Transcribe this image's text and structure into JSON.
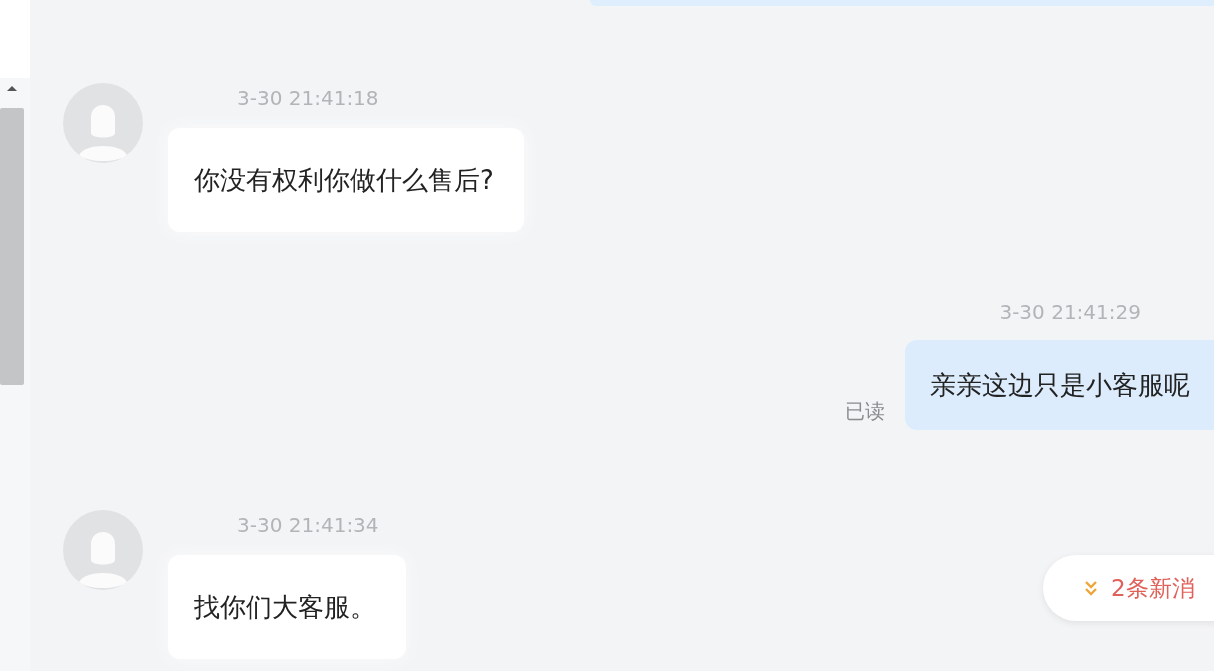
{
  "messages": [
    {
      "kind": "incoming",
      "time": "3-30 21:41:18",
      "text": "你没有权利你做什么售后?"
    },
    {
      "kind": "outgoing",
      "time": "3-30 21:41:29",
      "text": "亲亲这边只是小客服呢",
      "read_label": "已读"
    },
    {
      "kind": "incoming",
      "time": "3-30 21:41:34",
      "text": "找你们大客服。"
    }
  ],
  "new_messages_button": {
    "label": "2条新消"
  }
}
